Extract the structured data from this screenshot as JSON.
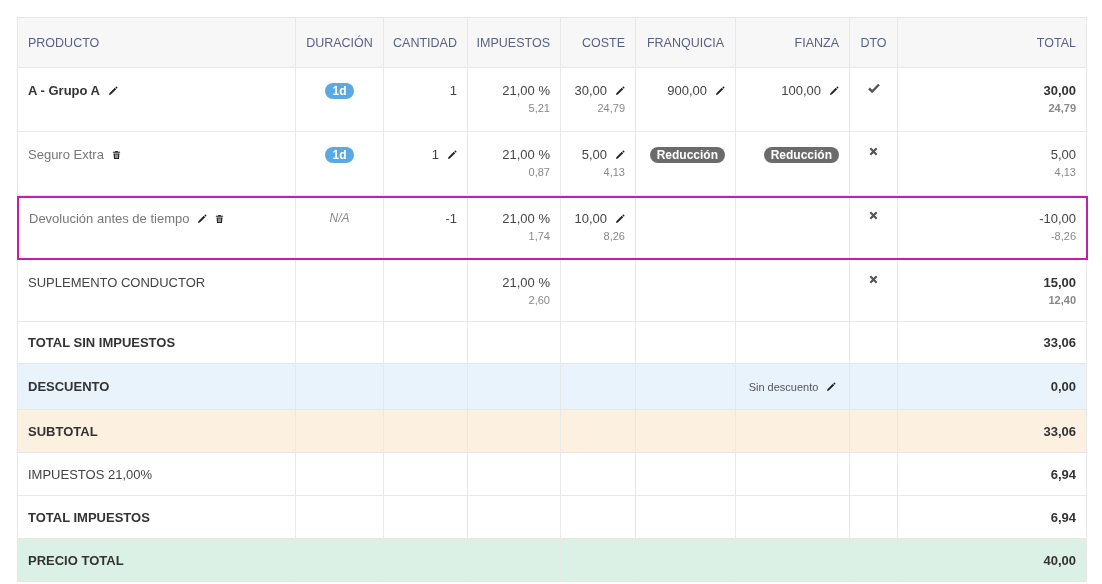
{
  "table": {
    "columns": [
      "PRODUCTO",
      "DURACIÓN",
      "CANTIDAD",
      "IMPUESTOS",
      "COSTE",
      "FRANQUICIA",
      "FIANZA",
      "DTO",
      "TOTAL"
    ],
    "items": [
      {
        "kind": "group",
        "product": "A - Grupo A",
        "editable": true,
        "deletable": false,
        "duration": {
          "kind": "badge",
          "text": "1d"
        },
        "quantity": {
          "text": "1",
          "editable": false
        },
        "tax": {
          "rate": "21,00 %",
          "amount": "5,21"
        },
        "cost": {
          "text": "30,00",
          "net": "24,79",
          "editable": true
        },
        "franchise": {
          "kind": "value",
          "text": "900,00",
          "editable": true
        },
        "deposit": {
          "kind": "value",
          "text": "100,00",
          "editable": true
        },
        "discount": {
          "kind": "check"
        },
        "total": {
          "text": "30,00",
          "net": "24,79"
        },
        "selected": false
      },
      {
        "kind": "extra",
        "product": "Seguro Extra",
        "editable": false,
        "deletable": true,
        "duration": {
          "kind": "badge",
          "text": "1d"
        },
        "quantity": {
          "text": "1",
          "editable": true
        },
        "tax": {
          "rate": "21,00 %",
          "amount": "0,87"
        },
        "cost": {
          "text": "5,00",
          "net": "4,13",
          "editable": true
        },
        "franchise": {
          "kind": "badge",
          "text": "Reducción"
        },
        "deposit": {
          "kind": "badge",
          "text": "Reducción"
        },
        "discount": {
          "kind": "cross"
        },
        "total": {
          "text": "5,00",
          "net": "4,13"
        },
        "selected": false
      },
      {
        "kind": "extra",
        "product": "Devolución antes de tiempo",
        "editable": true,
        "deletable": true,
        "duration": {
          "kind": "na",
          "text": "N/A"
        },
        "quantity": {
          "text": "-1",
          "editable": false
        },
        "tax": {
          "rate": "21,00 %",
          "amount": "1,74"
        },
        "cost": {
          "text": "10,00",
          "net": "8,26",
          "editable": true
        },
        "discount": {
          "kind": "cross"
        },
        "total": {
          "text": "-10,00",
          "net": "-8,26"
        },
        "selected": true
      },
      {
        "kind": "supplement",
        "product": "SUPLEMENTO CONDUCTOR",
        "editable": false,
        "deletable": false,
        "tax": {
          "rate": "21,00 %",
          "amount": "2,60"
        },
        "discount": {
          "kind": "cross"
        },
        "total": {
          "text": "15,00",
          "net": "12,40"
        },
        "selected": false
      }
    ],
    "summary": [
      {
        "kind": "net",
        "label": "TOTAL SIN IMPUESTOS",
        "total": "33,06"
      },
      {
        "kind": "discount",
        "label": "DESCUENTO",
        "note": "Sin descuento",
        "total": "0,00"
      },
      {
        "kind": "subtotal",
        "label": "SUBTOTAL",
        "total": "33,06"
      },
      {
        "kind": "tax",
        "label": "IMPUESTOS 21,00%",
        "total": "6,94"
      },
      {
        "kind": "net",
        "label": "TOTAL IMPUESTOS",
        "total": "6,94"
      },
      {
        "kind": "grand",
        "label": "PRECIO TOTAL",
        "total": "40,00"
      }
    ]
  }
}
